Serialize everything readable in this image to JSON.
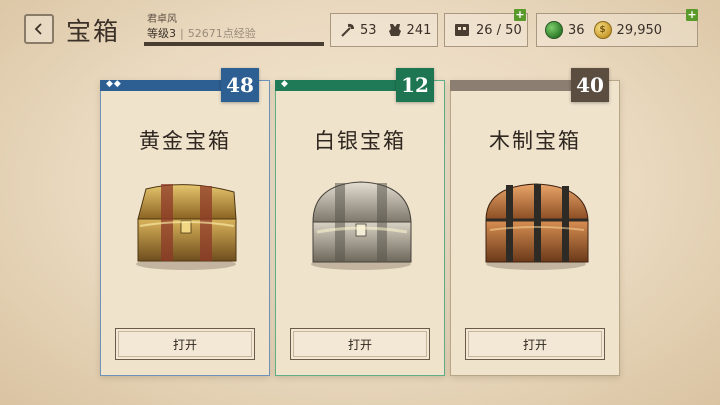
{
  "header": {
    "title": "宝箱",
    "player_name": "君卓风",
    "level_label": "等级3",
    "separator": "|",
    "xp_text": "52671点经验"
  },
  "resources": {
    "axe_value": "53",
    "ore_value": "241",
    "inventory_value": "26 / 50",
    "gem_value": "36",
    "gold_value": "29,950",
    "plus_label": "+"
  },
  "chests": [
    {
      "name": "黄金宝箱",
      "count": "48",
      "diamonds": "◆◆",
      "open_label": "打开"
    },
    {
      "name": "白银宝箱",
      "count": "12",
      "diamonds": "◆",
      "open_label": "打开"
    },
    {
      "name": "木制宝箱",
      "count": "40",
      "diamonds": "",
      "open_label": "打开"
    }
  ],
  "colors": {
    "gold_accent": "#2d5f92",
    "silver_accent": "#1e7552",
    "wood_accent": "#5b4d40",
    "plus_green": "#5a9a2a"
  }
}
